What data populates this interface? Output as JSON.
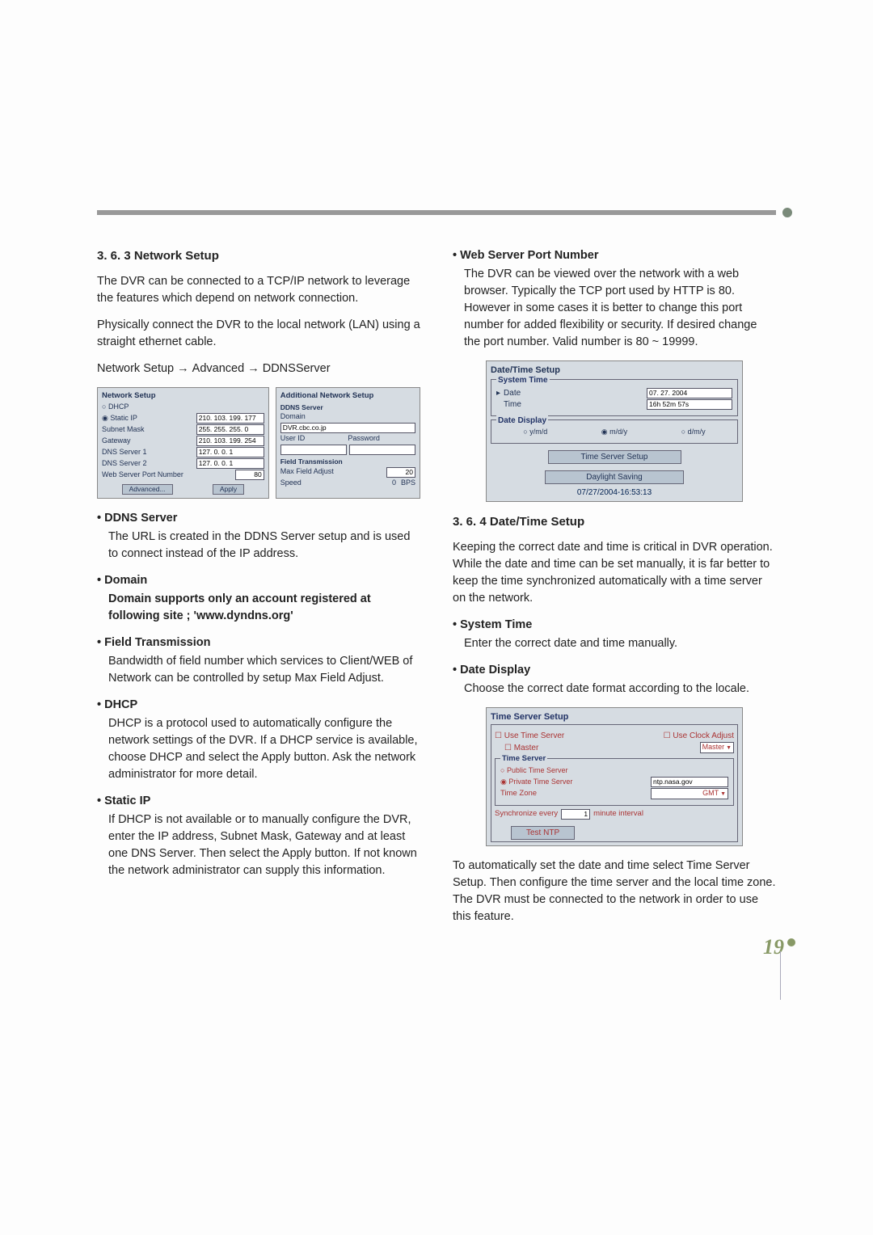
{
  "section_363_heading": "3. 6. 3 Network Setup",
  "para_363_1": "The DVR can be connected to a TCP/IP network to leverage the features which depend on network connection.",
  "para_363_2": "Physically connect the DVR to the local network (LAN) using a straight ethernet cable.",
  "breadcrumb_parts": {
    "a": "Network Setup",
    "b": "Advanced",
    "c": "DDNSServer"
  },
  "network_dlg": {
    "title": "Network Setup",
    "dhcp": "DHCP",
    "static_ip": "Static IP",
    "static_ip_val": "210. 103. 199. 177",
    "subnet": "Subnet Mask",
    "subnet_val": "255. 255. 255. 0",
    "gateway": "Gateway",
    "gateway_val": "210. 103. 199. 254",
    "dns1": "DNS Server 1",
    "dns1_val": "127. 0. 0. 1",
    "dns2": "DNS Server 2",
    "dns2_val": "127. 0. 0. 1",
    "wport": "Web Server Port Number",
    "wport_val": "80",
    "advanced_btn": "Advanced...",
    "apply_btn": "Apply"
  },
  "addl_dlg": {
    "title": "Additional Network Setup",
    "ddns_head": "DDNS Server",
    "domain": "Domain",
    "domain_val": "DVR.cbc.co.jp",
    "userid": "User ID",
    "password": "Password",
    "ft_head": "Field Transmission",
    "max_field": "Max Field Adjust",
    "max_field_val": "20",
    "speed": "Speed",
    "speed_val": "0",
    "bps": "BPS"
  },
  "bullets_left": {
    "ddns_head": "DDNS Server",
    "ddns_body": "The URL is created in the DDNS Server setup and is used to connect instead of the IP address.",
    "domain_head": "Domain",
    "domain_body": "Domain supports only an account registered at following site ; 'www.dyndns.org'",
    "ft_head": "Field Transmission",
    "ft_body": "Bandwidth of field number which services to Client/WEB of Network can be controlled by setup Max Field Adjust.",
    "dhcp_head": "DHCP",
    "dhcp_body": "DHCP is a protocol used to automatically configure the network settings of the DVR. If a DHCP service is available, choose DHCP and select the Apply button. Ask the network administrator for more detail.",
    "static_head": "Static IP",
    "static_body": "If DHCP is not available or to manually configure the DVR, enter the IP address, Subnet Mask, Gateway and at least one DNS Server. Then select the Apply button. If not known the network administrator can supply this information."
  },
  "bullets_right": {
    "wport_head": "Web Server Port Number",
    "wport_body": "The DVR can be viewed over the network with a web browser. Typically the TCP port used by HTTP is 80. However in some cases it is better to change this port number for added flexibility or security. If desired change the port number. Valid number is 80 ~ 19999."
  },
  "date_dlg": {
    "title": "Date/Time Setup",
    "system_time": "System Time",
    "date_lab": "Date",
    "date_val": "07. 27. 2004",
    "time_lab": "Time",
    "time_val": "16h 52m 57s",
    "date_display": "Date Display",
    "ymd": "y/m/d",
    "mdy": "m/d/y",
    "dmy": "d/m/y",
    "ts_btn": "Time Server Setup",
    "ds_btn": "Daylight Saving",
    "footer_time": "07/27/2004-16:53:13"
  },
  "section_364_heading": "3. 6. 4 Date/Time Setup",
  "para_364_1": "Keeping the correct date and time is critical in DVR operation. While the date and time can be set manually, it is far better to keep the time synchronized automatically with a time server on the network.",
  "bullets_364": {
    "st_head": "System Time",
    "st_body": "Enter the correct  date and time manually.",
    "dd_head": "Date Display",
    "dd_body": "Choose the correct date format according to the locale."
  },
  "ts_dlg": {
    "title": "Time Server Setup",
    "use_ts": "Use Time Server",
    "use_ca": "Use Clock Adjust",
    "master": "Master",
    "master_drop": "Master",
    "ts_section": "Time Server",
    "public": "Public Time Server",
    "private": "Private Time Server",
    "private_val": "ntp.nasa.gov",
    "tz": "Time Zone",
    "tz_val": "GMT",
    "sync_every": "Synchronize every",
    "sync_val": "1",
    "sync_unit": "minute interval",
    "test_btn": "Test NTP"
  },
  "para_364_2": "To automatically set the date and time select Time Server Setup. Then configure the time server and the local time zone. The DVR must be connected to the network in order to use this feature.",
  "page_number": "19"
}
